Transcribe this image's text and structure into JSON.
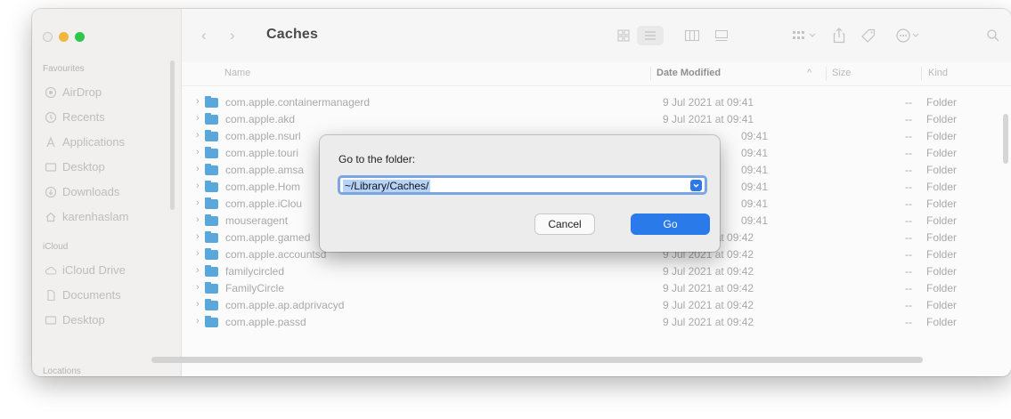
{
  "window": {
    "title": "Caches"
  },
  "sidebar": {
    "groups": [
      {
        "label": "Favourites",
        "items": [
          {
            "label": "AirDrop",
            "icon": "airdrop-icon"
          },
          {
            "label": "Recents",
            "icon": "clock-icon"
          },
          {
            "label": "Applications",
            "icon": "applications-icon"
          },
          {
            "label": "Desktop",
            "icon": "desktop-icon"
          },
          {
            "label": "Downloads",
            "icon": "download-icon"
          },
          {
            "label": "karenhaslam",
            "icon": "home-icon"
          }
        ]
      },
      {
        "label": "iCloud",
        "items": [
          {
            "label": "iCloud Drive",
            "icon": "cloud-icon"
          },
          {
            "label": "Documents",
            "icon": "document-icon"
          },
          {
            "label": "Desktop",
            "icon": "desktop-icon"
          }
        ]
      },
      {
        "label": "Locations",
        "items": []
      }
    ]
  },
  "columns": {
    "name": "Name",
    "date": "Date Modified",
    "sort": "^",
    "size": "Size",
    "kind": "Kind"
  },
  "files": [
    {
      "name": "com.apple.containermanagerd",
      "date": "9 Jul 2021 at 09:41",
      "size": "--",
      "kind": "Folder"
    },
    {
      "name": "com.apple.akd",
      "date": "9 Jul 2021 at 09:41",
      "size": "--",
      "kind": "Folder"
    },
    {
      "name": "com.apple.nsurl",
      "date": "09:41",
      "size": "--",
      "kind": "Folder"
    },
    {
      "name": "com.apple.touri",
      "date": "09:41",
      "size": "--",
      "kind": "Folder"
    },
    {
      "name": "com.apple.amsa",
      "date": "09:41",
      "size": "--",
      "kind": "Folder"
    },
    {
      "name": "com.apple.Hom",
      "date": "09:41",
      "size": "--",
      "kind": "Folder"
    },
    {
      "name": "com.apple.iClou",
      "date": "09:41",
      "size": "--",
      "kind": "Folder"
    },
    {
      "name": "mouseragent",
      "date": "09:41",
      "size": "--",
      "kind": "Folder"
    },
    {
      "name": "com.apple.gamed",
      "date": "9 Jul 2021 at 09:42",
      "size": "--",
      "kind": "Folder"
    },
    {
      "name": "com.apple.accountsd",
      "date": "9 Jul 2021 at 09:42",
      "size": "--",
      "kind": "Folder"
    },
    {
      "name": "familycircled",
      "date": "9 Jul 2021 at 09:42",
      "size": "--",
      "kind": "Folder"
    },
    {
      "name": "FamilyCircle",
      "date": "9 Jul 2021 at 09:42",
      "size": "--",
      "kind": "Folder"
    },
    {
      "name": "com.apple.ap.adprivacyd",
      "date": "9 Jul 2021 at 09:42",
      "size": "--",
      "kind": "Folder"
    },
    {
      "name": "com.apple.passd",
      "date": "9 Jul 2021 at 09:42",
      "size": "--",
      "kind": "Folder"
    }
  ],
  "dialog": {
    "prompt": "Go to the folder:",
    "input_value": "~/Library/Caches/",
    "cancel_label": "Cancel",
    "go_label": "Go"
  },
  "colors": {
    "accent": "#2b7ae9",
    "folder": "#5aa7dc",
    "selection": "#b7d3f8"
  }
}
